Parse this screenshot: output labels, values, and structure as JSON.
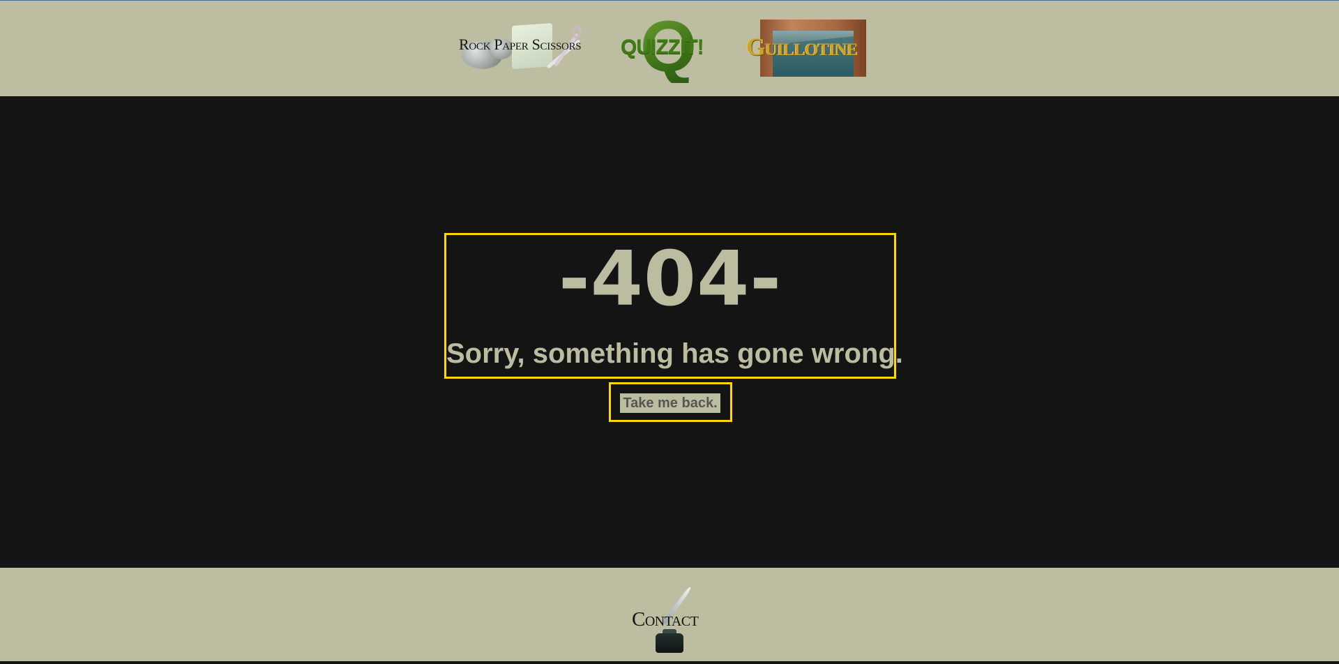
{
  "nav": {
    "links": [
      {
        "label": "Rock Paper Scissors"
      },
      {
        "label": "QUIZZIT!",
        "big_letter": "Q"
      },
      {
        "label": "Guillotine"
      }
    ]
  },
  "error": {
    "code": "-404-",
    "message": "Sorry, something has gone wrong.",
    "back_label": "Take me back."
  },
  "footer": {
    "contact_label": "Contact"
  },
  "colors": {
    "header_bg": "#bcbda1",
    "main_bg": "#141414",
    "text": "#bcbca1",
    "highlight_border": "#ffd60a"
  }
}
